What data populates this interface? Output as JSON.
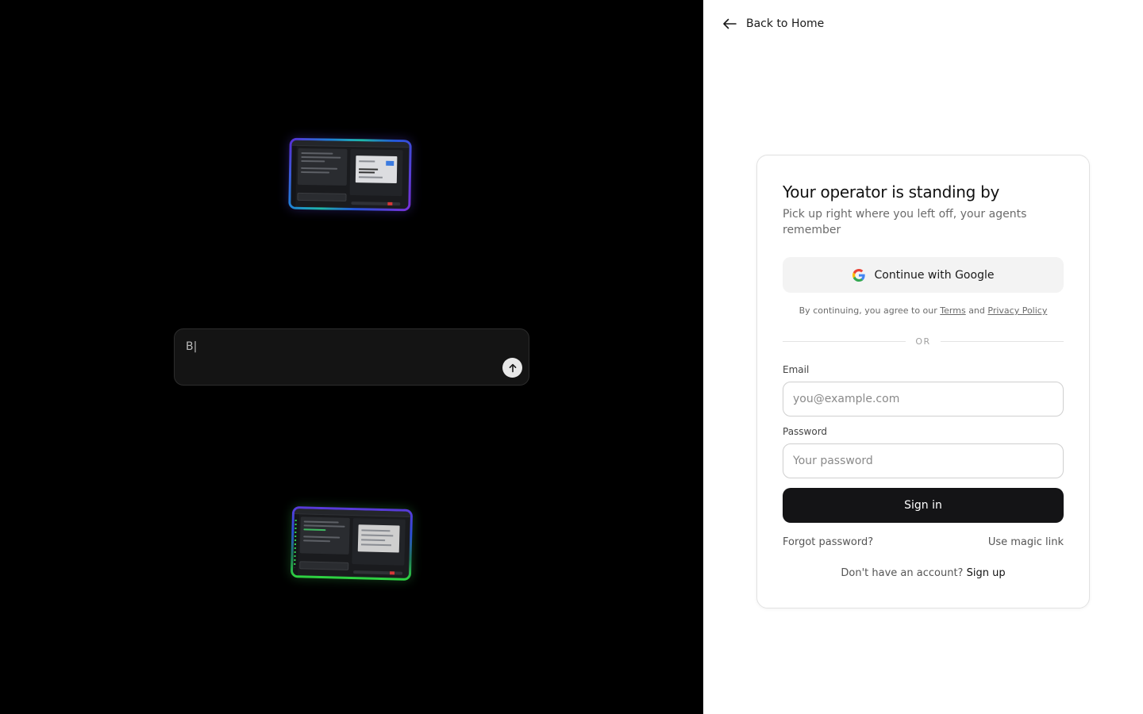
{
  "composer": {
    "value": "B|"
  },
  "back": {
    "label": "Back to Home"
  },
  "card": {
    "title": "Your operator is standing by",
    "subtitle": "Pick up right where you left off, your agents remember"
  },
  "google": {
    "label": "Continue with Google"
  },
  "legal": {
    "prefix": "By continuing, you agree to our",
    "terms": "Terms",
    "and": "and",
    "privacy": "Privacy Policy"
  },
  "divider": {
    "label": "OR"
  },
  "email": {
    "label": "Email",
    "placeholder": "you@example.com"
  },
  "password": {
    "label": "Password",
    "placeholder": "Your password"
  },
  "signin": {
    "label": "Sign in"
  },
  "links": {
    "forgot": "Forgot password?",
    "magic": "Use magic link"
  },
  "signup": {
    "prompt": "Don't have an account?",
    "action": "Sign up"
  },
  "colors": {
    "left_bg": "#000000",
    "primary_button": "#141416",
    "google_blue": "#4285F4",
    "google_red": "#EA4335",
    "google_yellow": "#FBBC05",
    "google_green": "#34A853"
  }
}
